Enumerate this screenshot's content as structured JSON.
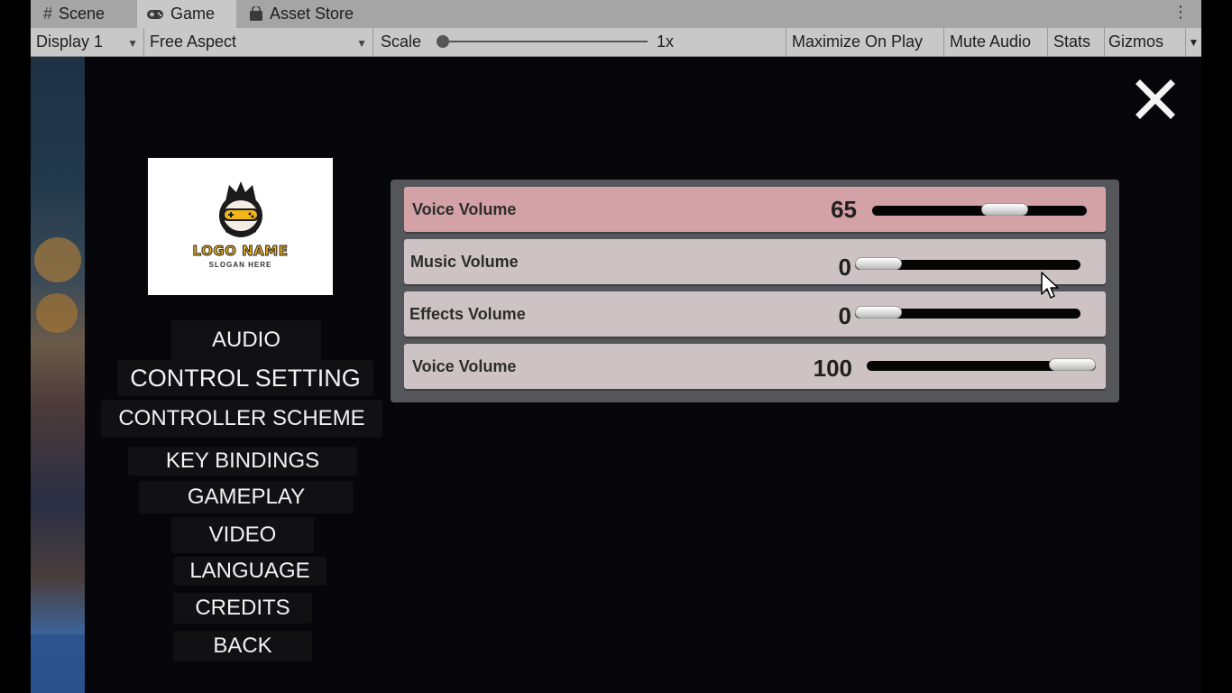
{
  "editor": {
    "tabs": [
      {
        "label": "Scene",
        "icon": "hash-icon"
      },
      {
        "label": "Game",
        "icon": "gamepad-icon"
      },
      {
        "label": "Asset Store",
        "icon": "shopping-bag-icon"
      }
    ],
    "tab_menu": "⋮",
    "toolbar": {
      "display": "Display 1",
      "aspect": "Free Aspect",
      "scale_label": "Scale",
      "scale_value": "1x",
      "maximize": "Maximize On Play",
      "mute": "Mute Audio",
      "stats": "Stats",
      "gizmos": "Gizmos"
    }
  },
  "logo": {
    "name": "LOGO NAME",
    "slogan": "SLOGAN HERE"
  },
  "menu": [
    "AUDIO",
    "CONTROL SETTING",
    "CONTROLLER SCHEME",
    "KEY BINDINGS",
    "GAMEPLAY",
    "VIDEO",
    "LANGUAGE",
    "CREDITS",
    "BACK"
  ],
  "audio_settings": [
    {
      "label": "Voice Volume",
      "value": "65",
      "level": 0.65,
      "highlighted": true
    },
    {
      "label": "Music Volume",
      "value": "0",
      "level": 0,
      "highlighted": false
    },
    {
      "label": "Effects Volume",
      "value": "0",
      "level": 0,
      "highlighted": false
    },
    {
      "label": "Voice Volume",
      "value": "100",
      "level": 1.0,
      "highlighted": false
    }
  ],
  "colors": {
    "highlight_row": "#d3a2a6",
    "row": "#cdc3c5",
    "panel": "#555659",
    "background": "#07060b"
  }
}
